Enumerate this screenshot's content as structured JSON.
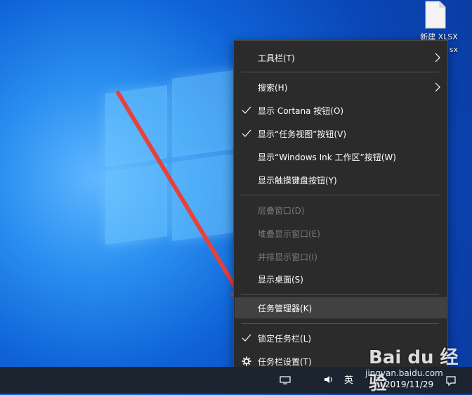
{
  "desktop": {
    "file_label": "新建 XLSX",
    "file_label_line2": "sx"
  },
  "menu": {
    "items": [
      {
        "label": "工具栏(T)",
        "submenu": true,
        "checked": false,
        "disabled": false
      },
      {
        "label": "搜索(H)",
        "submenu": true,
        "checked": false,
        "disabled": false
      },
      {
        "label": "显示 Cortana 按钮(O)",
        "submenu": false,
        "checked": true,
        "disabled": false
      },
      {
        "label": "显示“任务视图”按钮(V)",
        "submenu": false,
        "checked": true,
        "disabled": false
      },
      {
        "label": "显示“Windows Ink 工作区”按钮(W)",
        "submenu": false,
        "checked": false,
        "disabled": false
      },
      {
        "label": "显示触摸键盘按钮(Y)",
        "submenu": false,
        "checked": false,
        "disabled": false
      },
      {
        "label": "层叠窗口(D)",
        "submenu": false,
        "checked": false,
        "disabled": true
      },
      {
        "label": "堆叠显示窗口(E)",
        "submenu": false,
        "checked": false,
        "disabled": true
      },
      {
        "label": "并排显示窗口(I)",
        "submenu": false,
        "checked": false,
        "disabled": true
      },
      {
        "label": "显示桌面(S)",
        "submenu": false,
        "checked": false,
        "disabled": false
      },
      {
        "label": "任务管理器(K)",
        "submenu": false,
        "checked": false,
        "disabled": false,
        "highlighted": true
      },
      {
        "label": "锁定任务栏(L)",
        "submenu": false,
        "checked": true,
        "disabled": false
      },
      {
        "label": "任务栏设置(T)",
        "submenu": false,
        "checked": false,
        "disabled": false,
        "icon": "gear-icon"
      }
    ]
  },
  "taskbar": {
    "ime": "英",
    "date": "2019/11/29"
  },
  "watermark": {
    "brand": "Bai du 经验",
    "site": "jingyan.baidu.com"
  },
  "colors": {
    "menu_bg": "#2b2b2b",
    "menu_hover": "#414141",
    "arrow": "#e8403a"
  }
}
